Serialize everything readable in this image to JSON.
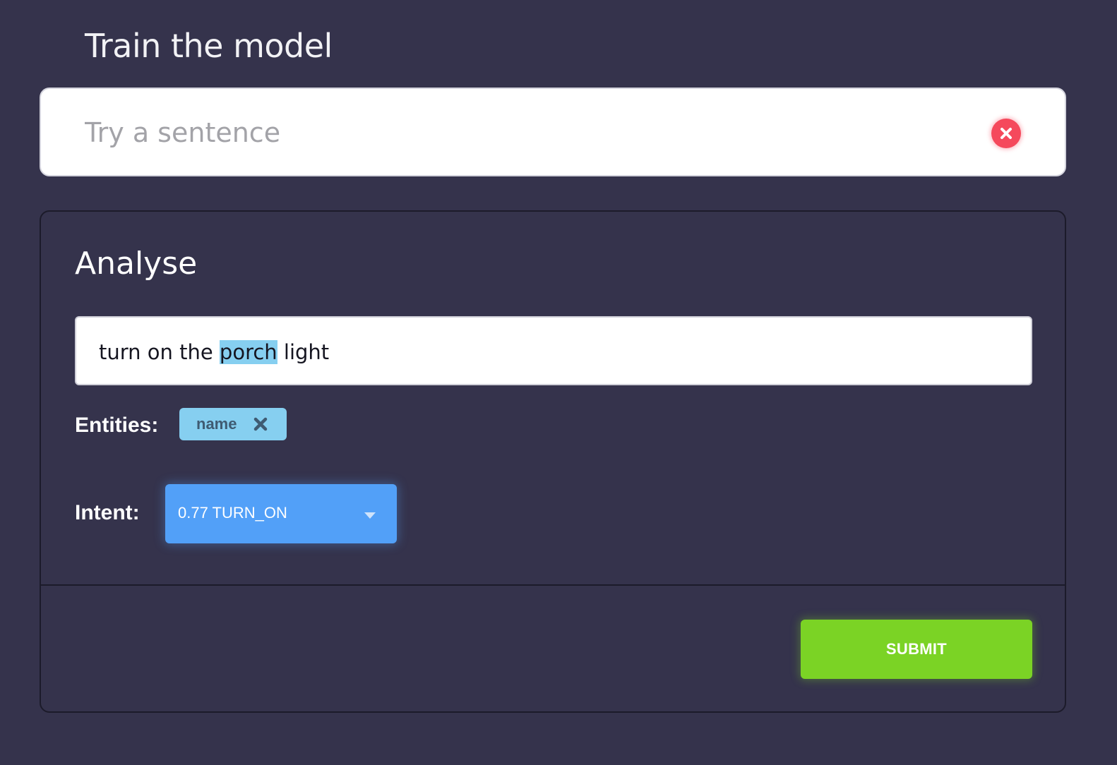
{
  "page": {
    "title": "Train the model"
  },
  "sentence": {
    "placeholder": "Try a sentence",
    "value": ""
  },
  "analyse": {
    "title": "Analyse",
    "text_before": "turn on the ",
    "entity_text": "porch",
    "text_after": " light",
    "entities_label": "Entities:",
    "entities": [
      {
        "label": "name"
      }
    ],
    "intent_label": "Intent:",
    "intent_value": "0.77 TURN_ON",
    "submit_label": "SUBMIT"
  },
  "icons": {
    "clear": "close-circle-icon",
    "chip_remove": "close-icon",
    "dropdown": "caret-down-icon"
  },
  "colors": {
    "background": "#35334c",
    "clear_button": "#f5495c",
    "entity_highlight": "#86cff0",
    "intent_select": "#52a0f8",
    "submit_button": "#7bd325"
  }
}
